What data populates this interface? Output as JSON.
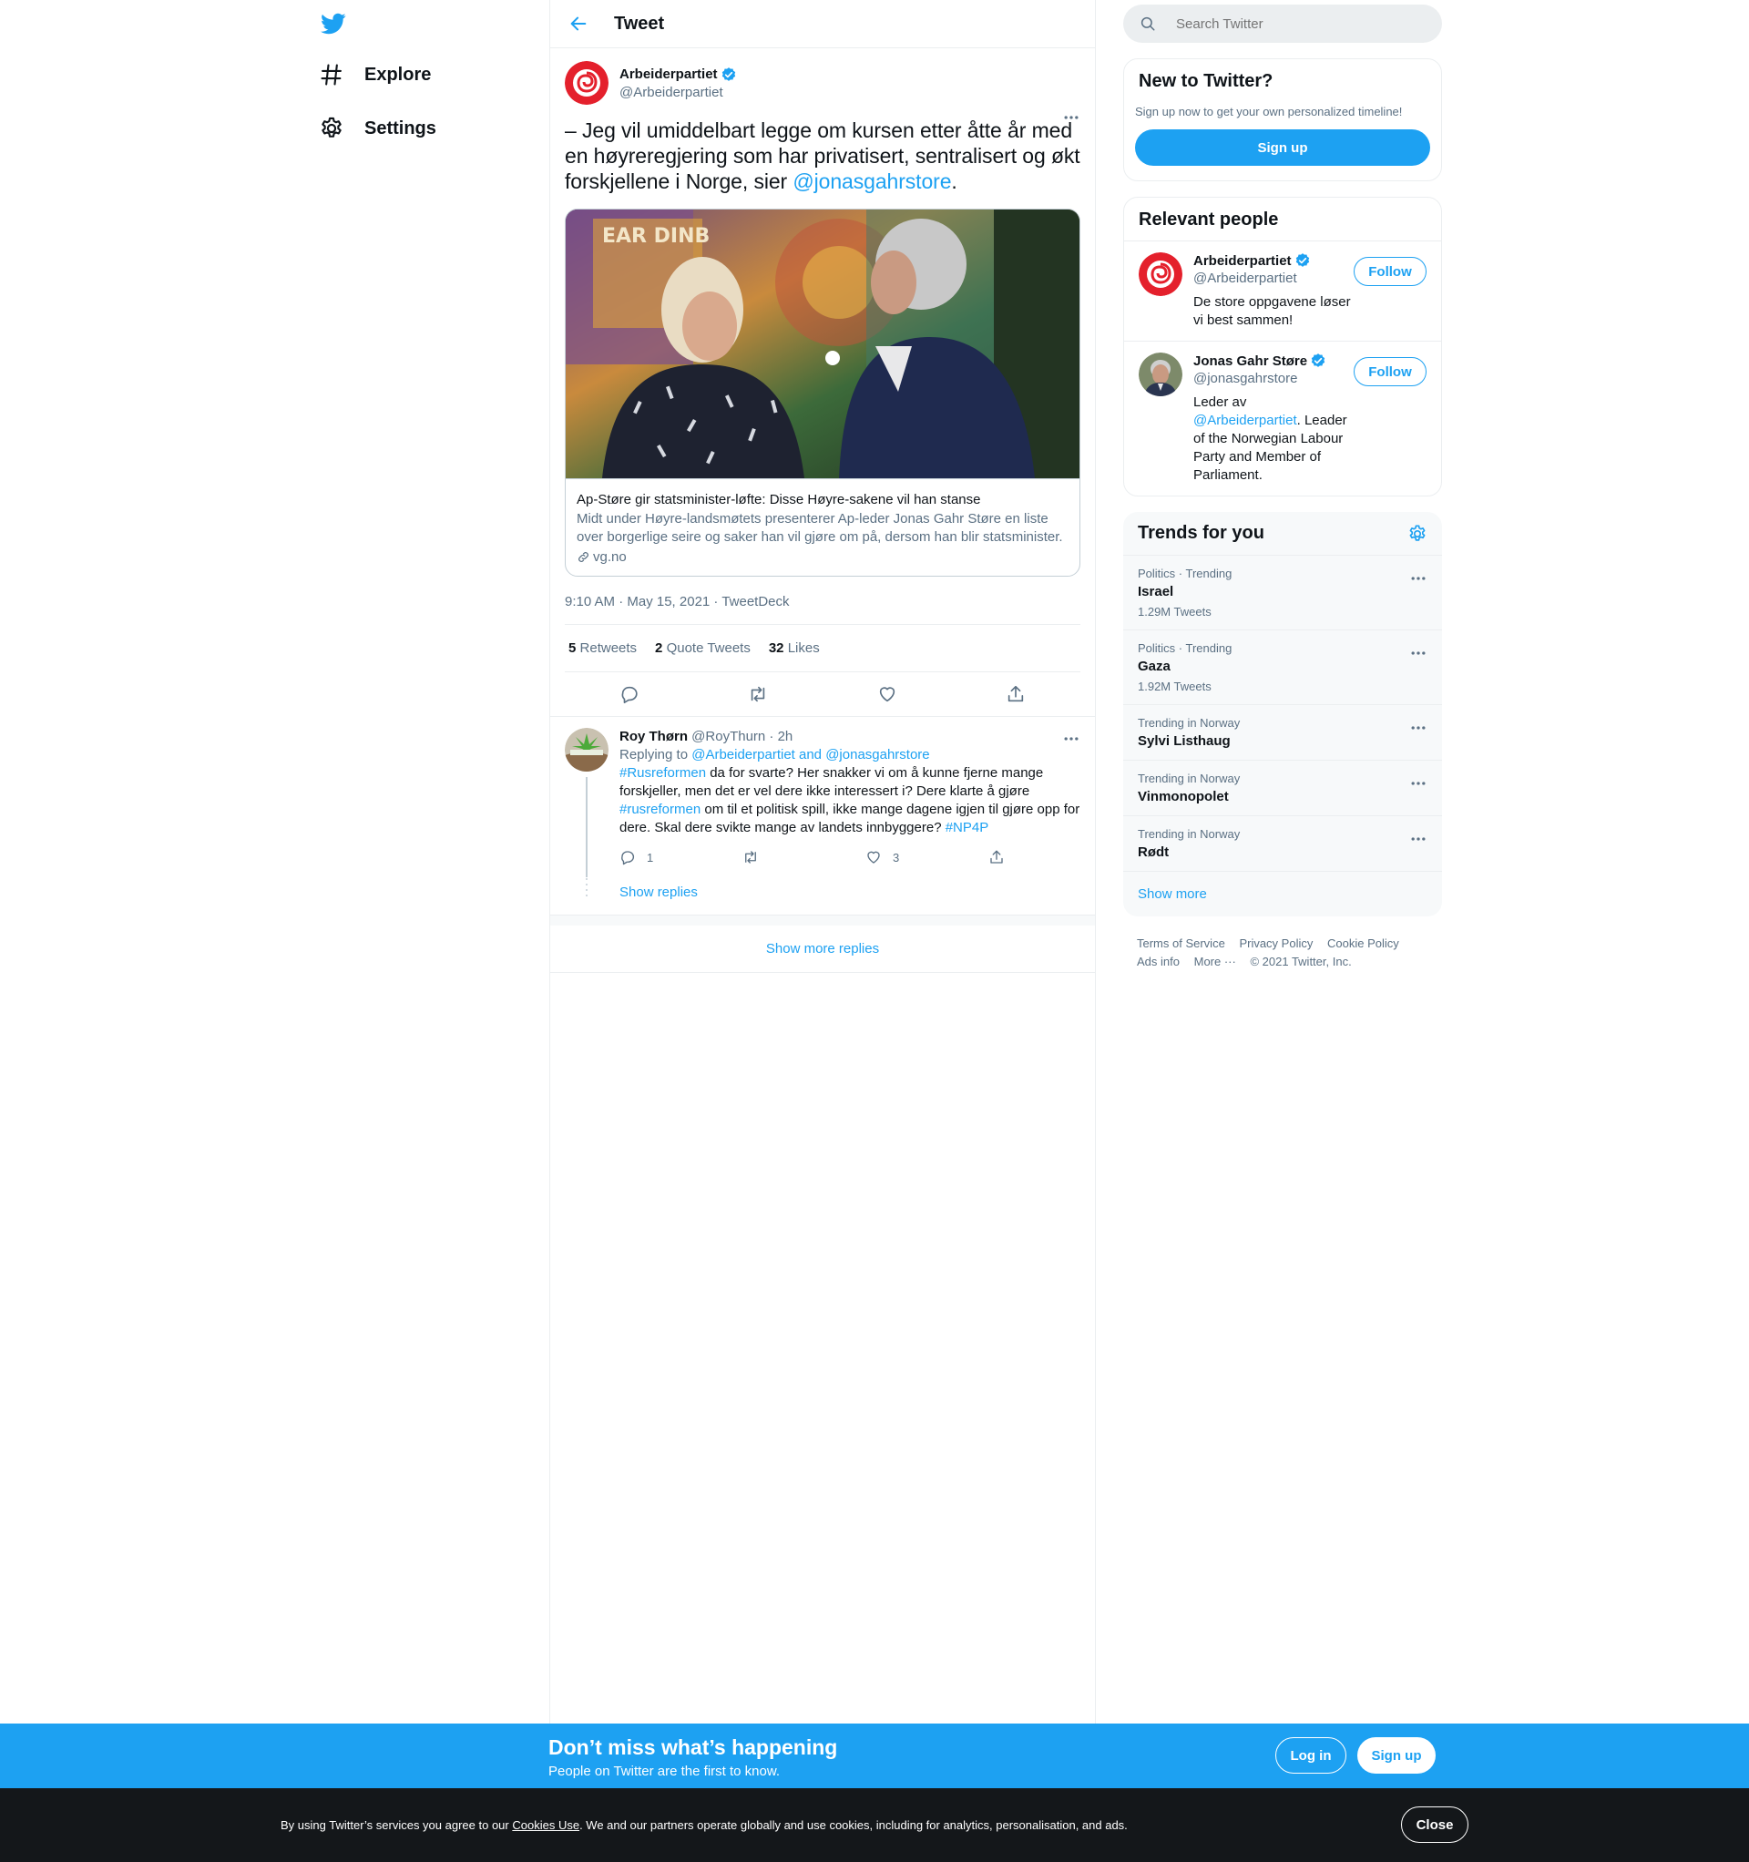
{
  "colors": {
    "accent": "#1da1f2",
    "text": "#0f1419",
    "muted": "#5b7083",
    "labour_red": "#e4202c"
  },
  "nav": {
    "logo_icon": "twitter-bird-icon",
    "items": [
      {
        "label": "Explore",
        "icon": "hashtag-icon"
      },
      {
        "label": "Settings",
        "icon": "gear-icon"
      }
    ]
  },
  "header": {
    "title": "Tweet"
  },
  "tweet": {
    "author_name": "Arbeiderpartiet",
    "author_handle": "@Arbeiderpartiet",
    "text_before": "– Jeg vil umiddelbart legge om kursen etter åtte år med en høyreregjering som har privatisert, sentralisert og økt forskjellene i Norge, sier ",
    "text_mention": "@jonasgahrstore",
    "text_after": ".",
    "card": {
      "title": "Ap-Støre gir statsminister-løfte: Disse Høyre-sakene vil han stanse",
      "description": "Midt under Høyre-landsmøtets presenterer Ap-leder Jonas Gahr Støre en liste over borgerlige seire og saker han vil gjøre om på, dersom han blir statsminister.",
      "source": "vg.no",
      "photo_text": "EAR DINB"
    },
    "timestamp": "9:10 AM · May 15, 2021 · TweetDeck",
    "stats": {
      "retweets_count": "5",
      "retweets_label": "Retweets",
      "quotes_count": "2",
      "quotes_label": "Quote Tweets",
      "likes_count": "32",
      "likes_label": "Likes"
    }
  },
  "reply": {
    "name": "Roy Thørn",
    "handle_time": "@RoyThurn · 2h",
    "replying_label": "Replying to ",
    "replying_to": "@Arbeiderpartiet and @jonasgahrstore",
    "hashtag1": "#Rusreformen",
    "text1": " da for svarte? Her snakker vi om å kunne fjerne mange forskjeller, men det er vel dere ikke interessert i? Dere klarte å gjøre ",
    "hashtag2": "#rusreformen",
    "text2": " om til et politisk spill, ikke mange dagene igjen til gjøre opp for dere. Skal dere svikte mange av landets innbyggere? ",
    "hashtag3": "#NP4P",
    "reply_count": "1",
    "like_count": "3",
    "show_replies": "Show replies"
  },
  "show_more_replies": "Show more replies",
  "search": {
    "placeholder": "Search Twitter"
  },
  "new_to_twitter": {
    "title": "New to Twitter?",
    "subtitle": "Sign up now to get your own personalized timeline!",
    "button": "Sign up"
  },
  "relevant_people": {
    "title": "Relevant people",
    "people": [
      {
        "name": "Arbeiderpartiet",
        "handle": "@Arbeiderpartiet",
        "bio": "De store oppgavene løser vi best sammen!",
        "follow": "Follow"
      },
      {
        "name": "Jonas Gahr Støre",
        "handle": "@jonasgahrstore",
        "bio_before": "Leder av ",
        "bio_mention": "@Arbeiderpartiet",
        "bio_after": ". Leader of the Norwegian Labour Party and Member of Parliament.",
        "follow": "Follow"
      }
    ]
  },
  "trends": {
    "title": "Trends for you",
    "items": [
      {
        "context": "Politics · Trending",
        "name": "Israel",
        "volume": "1.29M Tweets"
      },
      {
        "context": "Politics · Trending",
        "name": "Gaza",
        "volume": "1.92M Tweets"
      },
      {
        "context": "Trending in Norway",
        "name": "Sylvi Listhaug",
        "volume": ""
      },
      {
        "context": "Trending in Norway",
        "name": "Vinmonopolet",
        "volume": ""
      },
      {
        "context": "Trending in Norway",
        "name": "Rødt",
        "volume": ""
      }
    ],
    "show_more": "Show more"
  },
  "footer": {
    "links": [
      "Terms of Service",
      "Privacy Policy",
      "Cookie Policy",
      "Ads info",
      "More ···"
    ],
    "copyright": "© 2021 Twitter, Inc."
  },
  "banner": {
    "title": "Don’t miss what’s happening",
    "subtitle": "People on Twitter are the first to know.",
    "login": "Log in",
    "signup": "Sign up"
  },
  "cookie": {
    "text_before": "By using Twitter’s services you agree to our ",
    "link": "Cookies Use",
    "text_after": ". We and our partners operate globally and use cookies, including for analytics, personalisation, and ads.",
    "close": "Close"
  }
}
